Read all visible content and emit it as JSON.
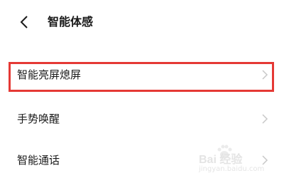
{
  "header": {
    "title": "智能体感",
    "back_icon": "chevron-left-icon"
  },
  "settings": [
    {
      "label": "智能亮屏熄屏",
      "chevron": "chevron-right-icon",
      "highlighted": true
    },
    {
      "label": "手势唤醒",
      "chevron": "chevron-right-icon"
    },
    {
      "label": "智能通话",
      "chevron": "chevron-right-icon"
    }
  ],
  "watermark": {
    "logo_text": "Bai 经验",
    "url": "jingyan.baidu.com"
  },
  "colors": {
    "highlight": "#e53935",
    "text": "#1a1a1a",
    "chevron": "#c8c8c8",
    "background": "#ffffff"
  }
}
